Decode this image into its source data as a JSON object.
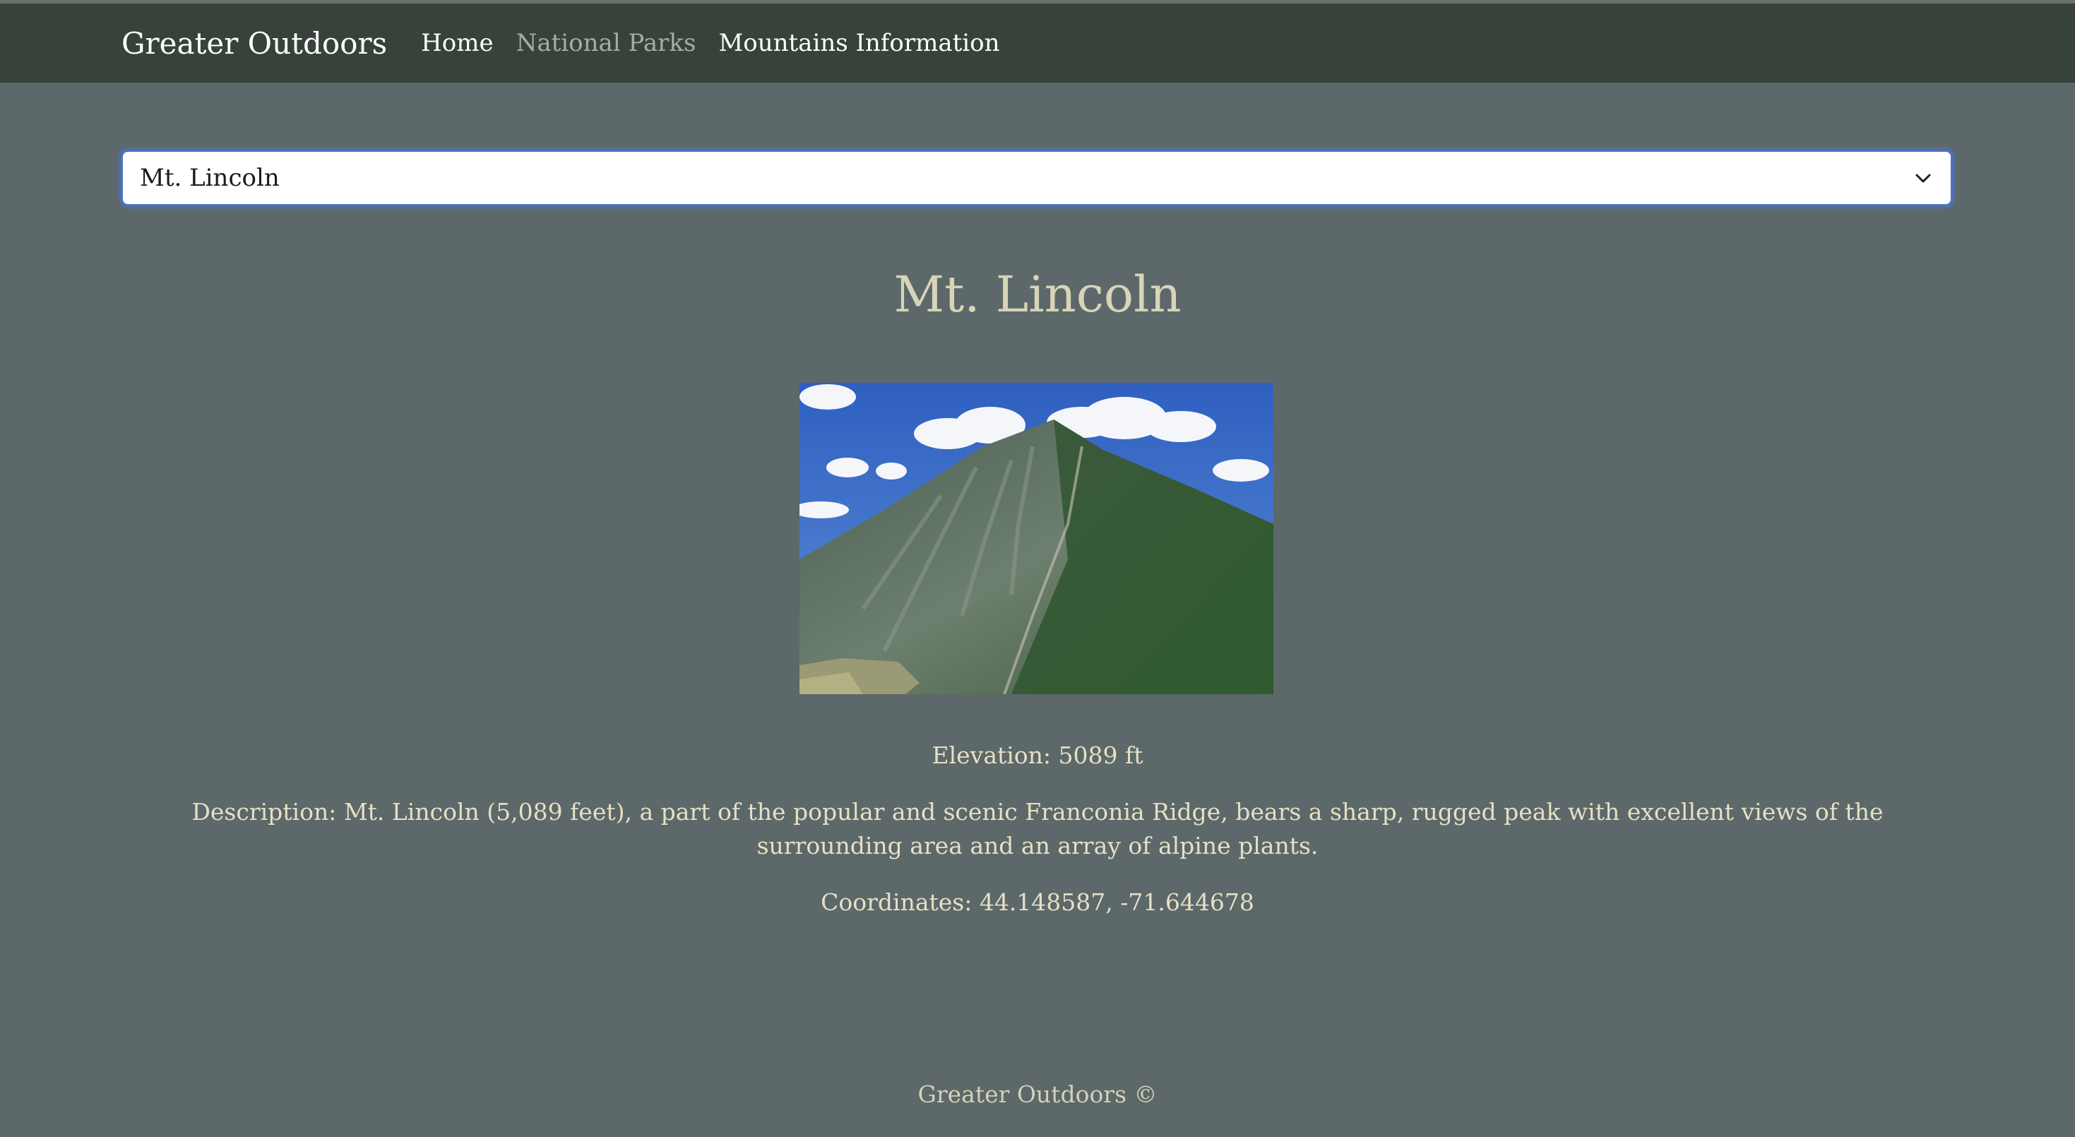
{
  "nav": {
    "brand": "Greater Outdoors",
    "links": [
      "Home",
      "National Parks",
      "Mountains Information"
    ]
  },
  "select": {
    "value": "Mt. Lincoln"
  },
  "mountain": {
    "name": "Mt. Lincoln",
    "elevation": "Elevation: 5089 ft",
    "description": "Description: Mt. Lincoln (5,089 feet), a part of the popular and scenic Franconia Ridge, bears a sharp, rugged peak with excellent views of the surrounding area and an array of alpine plants.",
    "coordinates": "Coordinates: 44.148587, -71.644678"
  },
  "footer": {
    "text": "Greater Outdoors ©"
  },
  "colors": {
    "page_bg": "#5c6869",
    "navbar_bg": "#37423b",
    "title": "#d8d4b8",
    "text": "#e6e0c4",
    "focus": "#4a72c8"
  },
  "icons": {
    "select_caret": "chevron-down-icon"
  }
}
